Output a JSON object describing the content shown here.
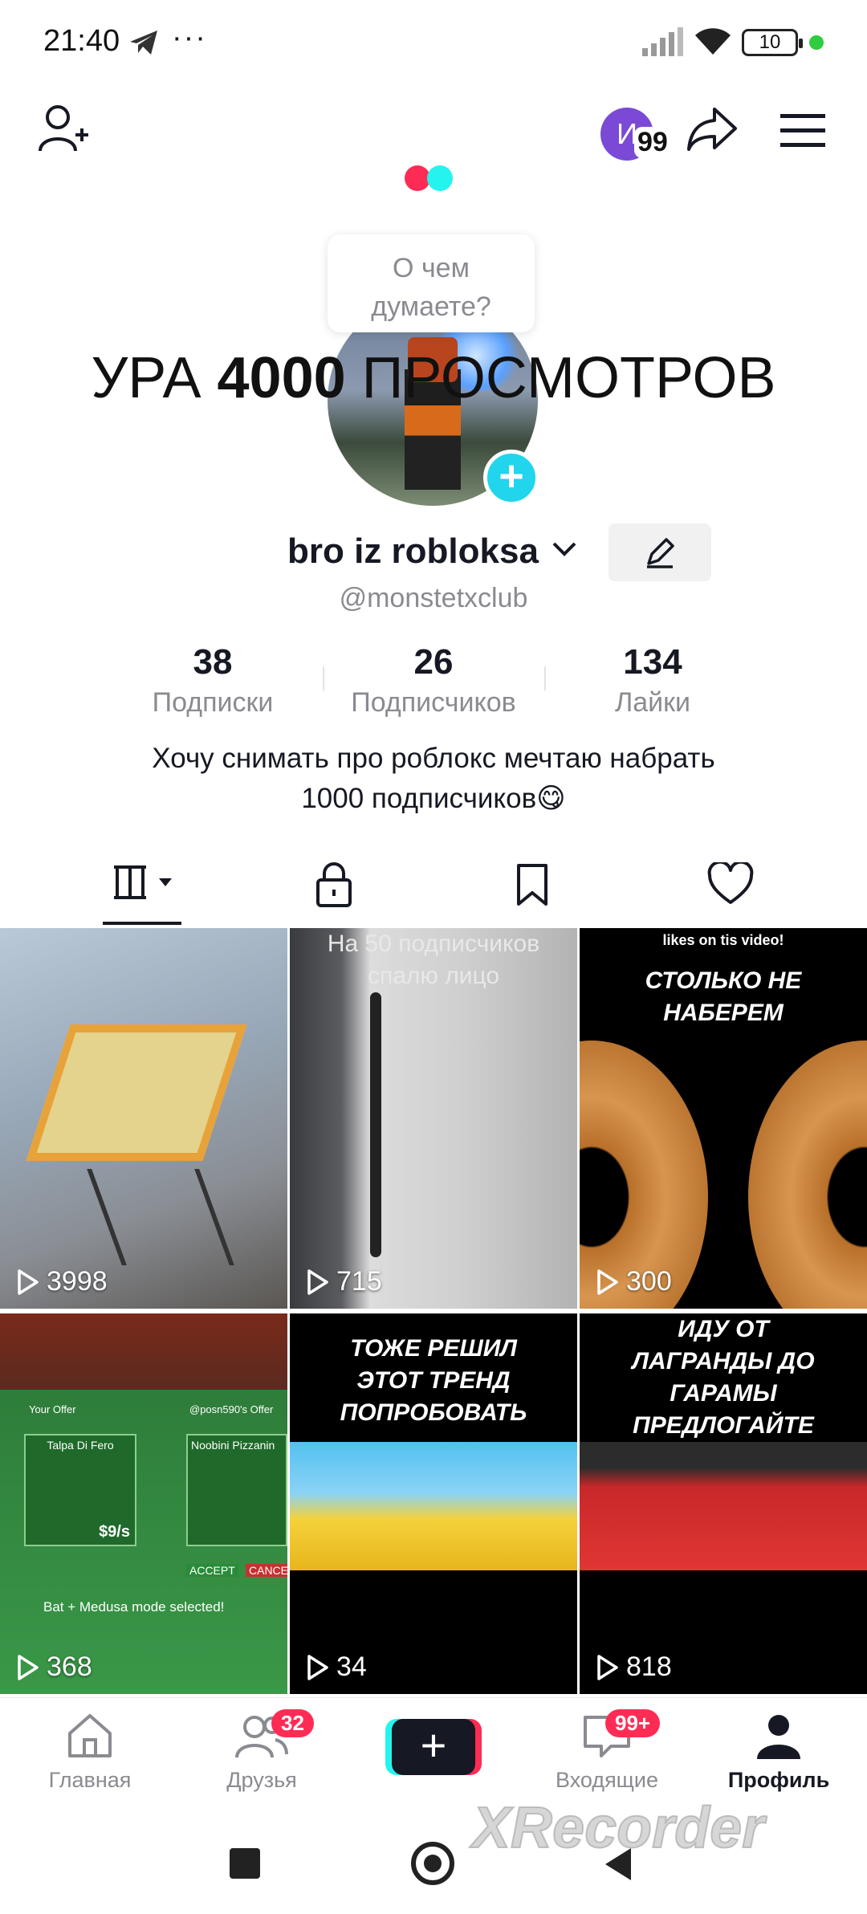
{
  "status_bar": {
    "time": "21:40",
    "dots": "···",
    "battery": "10"
  },
  "header": {
    "story_badge_letter": "И",
    "story_badge_count": "99"
  },
  "thought_bubble": {
    "line1": "О чем",
    "line2": "думаете?"
  },
  "overlay": {
    "prefix": "УРА ",
    "bold": "4000",
    "suffix": " ПРОСМОТРОВ"
  },
  "profile": {
    "username": "bro iz robloksa",
    "handle": "@monstetxclub",
    "bio_line1": "Хочу снимать про роблокс мечтаю набрать",
    "bio_line2": "1000 подписчиков😋"
  },
  "stats": [
    {
      "value": "38",
      "label": "Подписки"
    },
    {
      "value": "26",
      "label": "Подписчиков"
    },
    {
      "value": "134",
      "label": "Лайки"
    }
  ],
  "videos": [
    {
      "views": "3998",
      "caption": ""
    },
    {
      "views": "715",
      "caption": "На 50 подписчиков спалю лицо"
    },
    {
      "views": "300",
      "caption": "СТОЛЬКО НЕ НАБЕРЕМ",
      "top_text": "likes on tis video!"
    },
    {
      "views": "368",
      "caption": "",
      "left_label": "Your Offer",
      "right_label": "@posn590's Offer",
      "item_left": "Talpa Di Fero",
      "item_right": "Noobini Pizzanin",
      "price_left": "$9/s",
      "accept": "ACCEPT",
      "cancel": "CANCE",
      "mode": "Bat + Medusa mode selected!"
    },
    {
      "views": "34",
      "caption": "ТОЖЕ РЕШИЛ ЭТОТ ТРЕНД ПОПРОБОВАТЬ"
    },
    {
      "views": "818",
      "caption": "ИДУ ОТ ЛАГРАНДЫ ДО ГАРАМЫ ПРЕДЛОГАЙТЕ ТРЕЙДЫ"
    }
  ],
  "bottom_nav": [
    {
      "label": "Главная",
      "icon": "home-icon"
    },
    {
      "label": "Друзья",
      "icon": "friends-icon",
      "badge": "32"
    },
    {
      "label": "",
      "icon": "create-icon"
    },
    {
      "label": "Входящие",
      "icon": "inbox-icon",
      "badge": "99+"
    },
    {
      "label": "Профиль",
      "icon": "profile-icon"
    }
  ],
  "watermark": "XRecorder",
  "colors": {
    "accent_red": "#fe2c55",
    "accent_cyan": "#25f4ee",
    "text_primary": "#161823",
    "text_secondary": "#8a8b91"
  }
}
